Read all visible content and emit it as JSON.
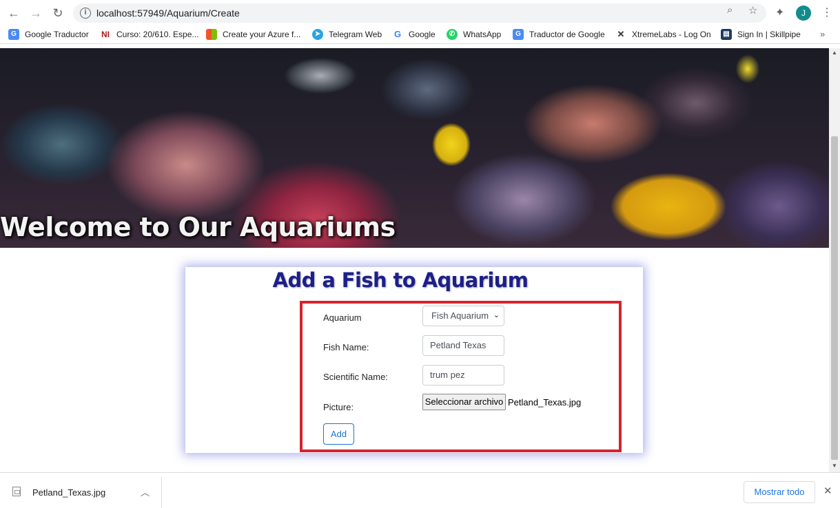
{
  "browser": {
    "url": "localhost:57949/Aquarium/Create",
    "avatar_letter": "J",
    "icons": [
      "back-arrow-icon",
      "forward-arrow-icon",
      "reload-icon",
      "site-info-icon",
      "zoom-icon",
      "star-icon",
      "extensions-icon",
      "menu-icon"
    ],
    "bookmarks": [
      {
        "label": "Google Traductor",
        "icon": "translate-icon",
        "color": "#4a8af4"
      },
      {
        "label": "Curso: 20/610. Espe...",
        "icon": "ni-icon",
        "color": "#a81c1c"
      },
      {
        "label": "Create your Azure f...",
        "icon": "microsoft-icon",
        "color": "#f35325"
      },
      {
        "label": "Telegram Web",
        "icon": "telegram-icon",
        "color": "#2aa3e0"
      },
      {
        "label": "Google",
        "icon": "google-icon",
        "color": "#4285f4"
      },
      {
        "label": "WhatsApp",
        "icon": "whatsapp-icon",
        "color": "#25d366"
      },
      {
        "label": "Traductor de Google",
        "icon": "translate-icon",
        "color": "#4a8af4"
      },
      {
        "label": "XtremeLabs - Log On",
        "icon": "x-icon",
        "color": "#333333"
      },
      {
        "label": "Sign In | Skillpipe",
        "icon": "skillpipe-icon",
        "color": "#1e3a5f"
      }
    ],
    "more_bookmarks": "»"
  },
  "hero": {
    "title": "Welcome to Our Aquariums"
  },
  "form": {
    "title": "Add a Fish to Aquarium",
    "aquarium_label": "Aquarium",
    "aquarium_value": "Fish Aquarium",
    "fish_name_label": "Fish Name:",
    "fish_name_value": "Petland Texas",
    "scientific_name_label": "Scientific Name:",
    "scientific_name_value": "trum pez",
    "picture_label": "Picture:",
    "file_button_label": "Seleccionar archivo",
    "file_name": "Petland_Texas.jpg",
    "add_button_label": "Add"
  },
  "download_bar": {
    "file_name": "Petland_Texas.jpg",
    "show_all_label": "Mostrar todo"
  },
  "colors": {
    "card_title": "#1c1f8a",
    "highlight_border": "#d6232d",
    "add_button": "#1b76d1",
    "card_glow": "#4650d2"
  }
}
